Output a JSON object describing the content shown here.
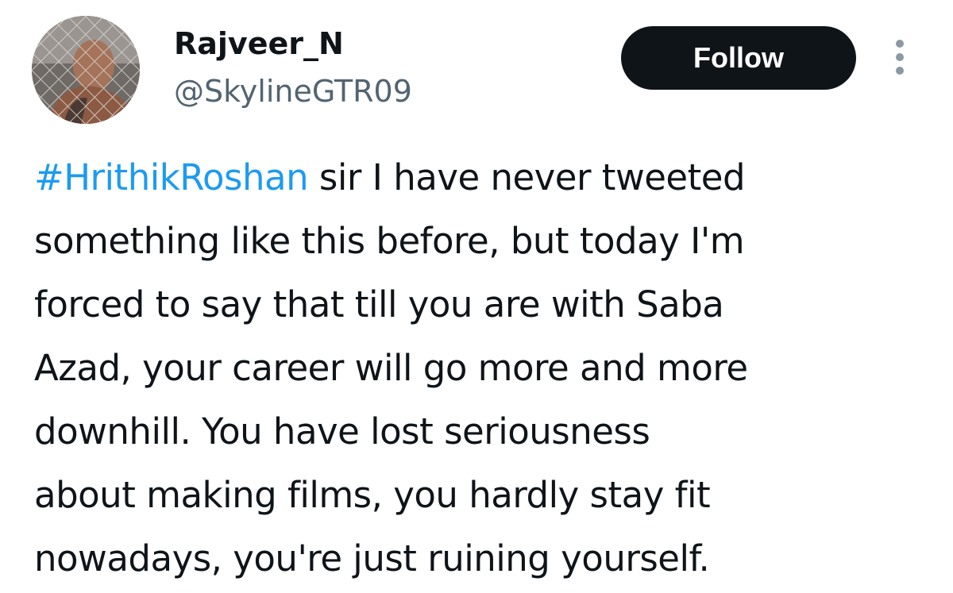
{
  "user": {
    "display_name": "Rajveer_N",
    "handle": "@SkylineGTR09"
  },
  "actions": {
    "follow_label": "Follow",
    "more_icon": "more-vertical-icon"
  },
  "tweet": {
    "hashtag": "#HrithikRoshan",
    "lines": [
      " sir I have never tweeted",
      "something like this before, but today I'm",
      "forced to say that till you are with Saba",
      "Azad, your career will go more and more",
      "downhill. You have lost seriousness",
      "about making films, you hardly stay fit",
      "nowadays, you're just ruining yourself."
    ]
  },
  "colors": {
    "text": "#0f1419",
    "secondary_text": "#536471",
    "link": "#1d9bf0",
    "follow_button_bg": "#0f1419",
    "follow_button_text": "#ffffff",
    "more_icon": "#8b98a5"
  }
}
